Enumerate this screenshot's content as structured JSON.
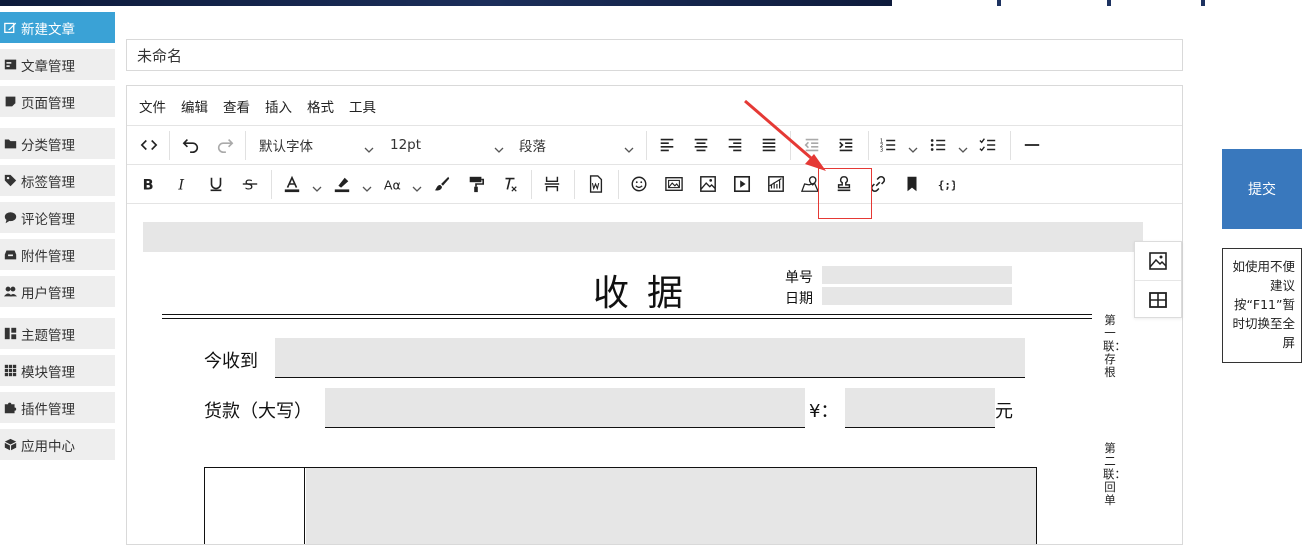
{
  "sidebar": {
    "items": [
      {
        "label": "新建文章",
        "icon": "edit-icon"
      },
      {
        "label": "文章管理",
        "icon": "article-icon"
      },
      {
        "label": "页面管理",
        "icon": "page-icon"
      },
      {
        "label": "分类管理",
        "icon": "folder-icon"
      },
      {
        "label": "标签管理",
        "icon": "tag-icon"
      },
      {
        "label": "评论管理",
        "icon": "comment-icon"
      },
      {
        "label": "附件管理",
        "icon": "inbox-icon"
      },
      {
        "label": "用户管理",
        "icon": "users-icon"
      },
      {
        "label": "主题管理",
        "icon": "layout-icon"
      },
      {
        "label": "模块管理",
        "icon": "grid-icon"
      },
      {
        "label": "插件管理",
        "icon": "puzzle-icon"
      },
      {
        "label": "应用中心",
        "icon": "cube-icon"
      }
    ]
  },
  "title": {
    "value": "未命名"
  },
  "editor": {
    "menu": [
      "文件",
      "编辑",
      "查看",
      "插入",
      "格式",
      "工具"
    ],
    "font_family": "默认字体",
    "font_size": "12pt",
    "block_format": "段落"
  },
  "document": {
    "title": "收据",
    "no_label": "单号",
    "date_label": "日期",
    "received_label": "今收到",
    "amount_label": "货款（大写）",
    "currency_label": "¥：",
    "yuan_label": "元",
    "copy1": "第一联：存根",
    "copy2": "第二联：回单"
  },
  "actions": {
    "submit_label": "提交",
    "tip": "如使用不便建议按“F11”暂时切换至全屏"
  },
  "colors": {
    "active_sidebar": "#3aa2d6",
    "submit_bg": "#3978bd",
    "highlight": "#e53935"
  }
}
